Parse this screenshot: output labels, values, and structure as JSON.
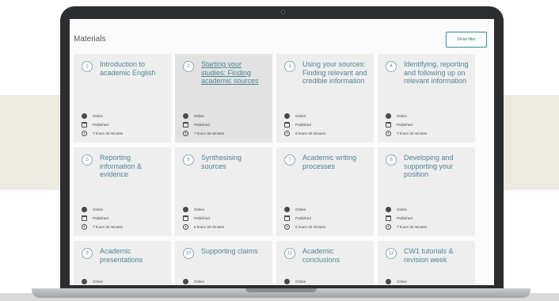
{
  "page": {
    "title": "Materials",
    "filter_button": "Show filter"
  },
  "cards": [
    {
      "num": "1",
      "title": "Introduction to academic English",
      "mode": "Online",
      "status": "Published",
      "duration": "7 hours 30 minutes"
    },
    {
      "num": "2",
      "title": "Starting your studies: Finding academic sources",
      "mode": "Online",
      "status": "Published",
      "duration": "7 hours 30 minutes"
    },
    {
      "num": "3",
      "title": "Using your sources: Finding relevant and credible information",
      "mode": "Online",
      "status": "Published",
      "duration": "6 hours 30 minutes"
    },
    {
      "num": "4",
      "title": "Identifying, reporting and following up on relevant information",
      "mode": "Online",
      "status": "Published",
      "duration": "7 hours 30 minutes"
    },
    {
      "num": "5",
      "title": "Reporting information & evidence",
      "mode": "Online",
      "status": "Published",
      "duration": "7 hours 30 minutes"
    },
    {
      "num": "6",
      "title": "Synthesising sources",
      "mode": "Online",
      "status": "Published",
      "duration": "6 hours 30 minutes"
    },
    {
      "num": "7",
      "title": "Academic writing processes",
      "mode": "Online",
      "status": "Published",
      "duration": "6 hours 30 minutes"
    },
    {
      "num": "8",
      "title": "Developing and supporting your position",
      "mode": "Online",
      "status": "Published",
      "duration": "7 hours 30 minutes"
    },
    {
      "num": "9",
      "title": "Academic presentations",
      "mode": "Online"
    },
    {
      "num": "10",
      "title": "Supporting claims",
      "mode": "Online"
    },
    {
      "num": "11",
      "title": "Academic conclusions",
      "mode": "Online"
    },
    {
      "num": "12",
      "title": "CW1 tutorials & revision week",
      "mode": "Online"
    }
  ]
}
